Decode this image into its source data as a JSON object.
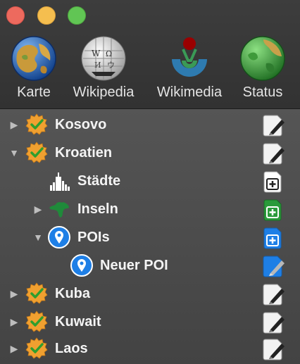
{
  "window": {
    "traffic_lights": {
      "close": "#ed6a5e",
      "minimize": "#f5be4f",
      "maximize": "#61c554"
    }
  },
  "toolbar": {
    "items": [
      {
        "label": "Karte",
        "icon": "globe-icon"
      },
      {
        "label": "Wikipedia",
        "icon": "wikipedia-globe-icon"
      },
      {
        "label": "Wikimedia",
        "icon": "wikimedia-logo-icon"
      },
      {
        "label": "Status",
        "icon": "status-globe-icon"
      }
    ]
  },
  "outline": {
    "rows": [
      {
        "label": "Kosovo",
        "disclosure": "collapsed",
        "icon": "verified-badge-icon",
        "action_icon": "edit-note-icon"
      },
      {
        "label": "Kroatien",
        "disclosure": "expanded",
        "icon": "verified-badge-icon",
        "action_icon": "edit-note-icon"
      },
      {
        "label": "Städte",
        "disclosure": "none",
        "icon": "city-skyline-icon",
        "action_icon": "add-note-icon"
      },
      {
        "label": "Inseln",
        "disclosure": "collapsed",
        "icon": "island-icon",
        "action_icon": "add-note-green-icon"
      },
      {
        "label": "POIs",
        "disclosure": "expanded",
        "icon": "location-pin-icon",
        "action_icon": "add-note-blue-icon"
      },
      {
        "label": "Neuer POI",
        "disclosure": "none",
        "icon": "location-pin-icon",
        "action_icon": "edit-note-blue-icon"
      },
      {
        "label": "Kuba",
        "disclosure": "collapsed",
        "icon": "verified-badge-icon",
        "action_icon": "edit-note-icon"
      },
      {
        "label": "Kuwait",
        "disclosure": "collapsed",
        "icon": "verified-badge-icon",
        "action_icon": "edit-note-icon"
      },
      {
        "label": "Laos",
        "disclosure": "collapsed",
        "icon": "verified-badge-icon",
        "action_icon": "edit-note-icon"
      }
    ]
  },
  "colors": {
    "badge_orange": "#f0a030",
    "check_green": "#2e9e2e",
    "pin_blue": "#1e7fe6",
    "island_green": "#1f8a3a",
    "label_text": "#f4f4f4",
    "toolbar_text": "#e4e4e4"
  }
}
